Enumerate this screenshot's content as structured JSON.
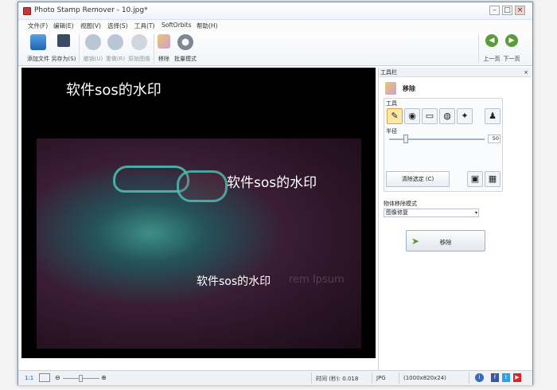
{
  "window": {
    "title": "Photo Stamp Remover - 10.jpg*"
  },
  "menu": [
    "文件(F)",
    "编辑(E)",
    "视图(V)",
    "选择(S)",
    "工具(T)",
    "SoftOrbits",
    "帮助(H)"
  ],
  "toolbar": {
    "add_file": "添加文件",
    "save_as": "另存为(S)",
    "undo": "撤销(U)",
    "redo": "重做(R)",
    "restore": "原始图像",
    "remove": "移除",
    "batch": "批量模式",
    "prev": "上一页",
    "next": "下一页"
  },
  "canvas": {
    "watermarks": [
      "软件sos的水印",
      "软件sos的水印",
      "软件sos的水印"
    ],
    "lorem": "rem Ipsum"
  },
  "panel": {
    "title": "工具栏",
    "section": "移除",
    "tools_label": "工具",
    "radius_label": "半径",
    "radius_value": "50",
    "clear_selection": "清除选定 (C)",
    "mode_label": "物体移除模式",
    "mode_value": "图像修复",
    "remove_button": "移除"
  },
  "status": {
    "zoom": "1:1",
    "time": "时间 (秒): 0.018",
    "format": "JPG",
    "dimensions": "(1000x820x24)"
  }
}
